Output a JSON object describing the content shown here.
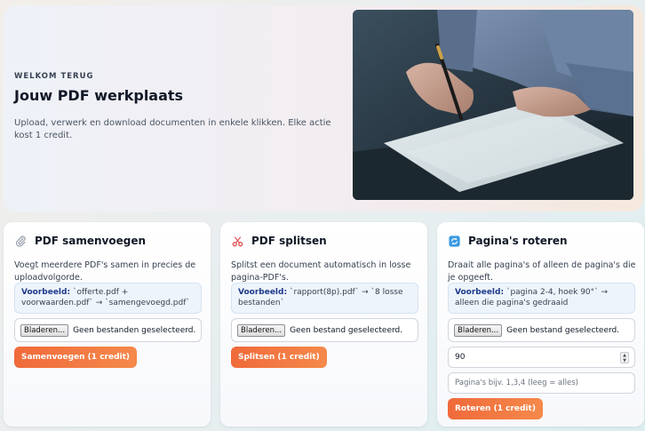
{
  "hero": {
    "eyebrow": "WELKOM TERUG",
    "title": "Jouw PDF werkplaats",
    "lead": "Upload, verwerk en download documenten in enkele klikken. Elke actie kost 1 credit."
  },
  "cards": [
    {
      "title": "PDF samenvoegen",
      "icon": "paperclip-icon",
      "description": "Voegt meerdere PDF's samen in precies de uploadvolgorde.",
      "example_label": "Voorbeeld:",
      "example_text": "`offerte.pdf + voorwaarden.pdf` → `samengevoegd.pdf`",
      "browse_label": "Bladeren...",
      "file_status": "Geen bestanden geselecteerd.",
      "button_label": "Samenvoegen (1 credit)"
    },
    {
      "title": "PDF splitsen",
      "icon": "scissors-icon",
      "description": "Splitst een document automatisch in losse pagina-PDF's.",
      "example_label": "Voorbeeld:",
      "example_text": "`rapport(8p).pdf` → `8 losse bestanden`",
      "browse_label": "Bladeren...",
      "file_status": "Geen bestand geselecteerd.",
      "button_label": "Splitsen (1 credit)"
    },
    {
      "title": "Pagina's roteren",
      "icon": "rotate-icon",
      "description": "Draait alle pagina's of alleen de pagina's die je opgeeft.",
      "example_label": "Voorbeeld:",
      "example_text": "`pagina 2-4, hoek 90°` → alleen die pagina's gedraaid",
      "browse_label": "Bladeren...",
      "file_status": "Geen bestand geselecteerd.",
      "angle_value": "90",
      "pages_placeholder": "Pagina's bijv. 1,3,4 (leeg = alles)",
      "button_label": "Roteren (1 credit)"
    }
  ],
  "colors": {
    "accent": "#f06a3a",
    "example_bg": "#eef4fb",
    "example_label": "#1e3a8a"
  }
}
